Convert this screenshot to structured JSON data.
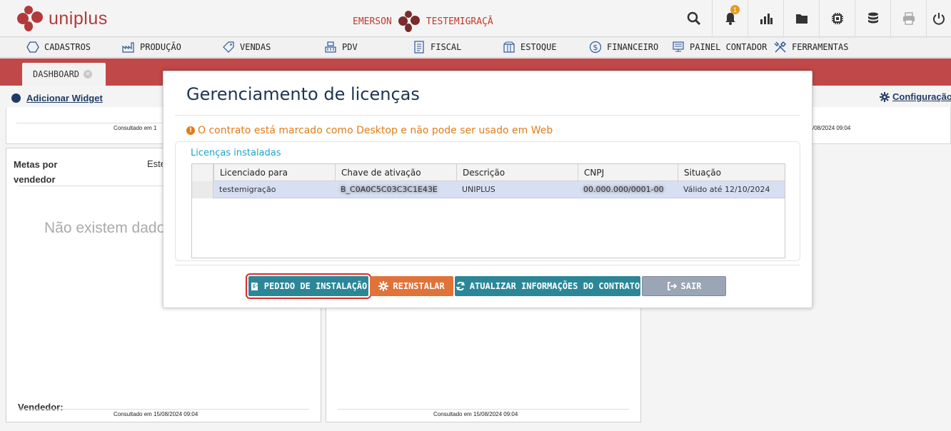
{
  "app": {
    "logo_text": "uniplus",
    "user_name": "EMERSON",
    "company": "TESTEMIGRAÇÃ",
    "notification_count": "1"
  },
  "menu": {
    "items": [
      {
        "label": "CADASTROS",
        "icon": "hexagon-icon"
      },
      {
        "label": "PRODUÇÃO",
        "icon": "factory-icon"
      },
      {
        "label": "VENDAS",
        "icon": "tag-icon"
      },
      {
        "label": "PDV",
        "icon": "register-icon"
      },
      {
        "label": "FISCAL",
        "icon": "document-icon"
      },
      {
        "label": "ESTOQUE",
        "icon": "box-icon"
      },
      {
        "label": "FINANCEIRO",
        "icon": "dollar-icon"
      },
      {
        "label": "PAINEL CONTADOR",
        "icon": "monitor-icon"
      },
      {
        "label": "FERRAMENTAS",
        "icon": "tools-icon"
      }
    ]
  },
  "tabs": {
    "dashboard": "DASHBOARD"
  },
  "dashboard": {
    "add_widget": "Adicionar Widget",
    "config": "Configuração",
    "consult_left": "Consultado em 1",
    "consult_right": "/08/2024 09:04",
    "widget1": {
      "title_line1": "Metas por",
      "title_line2": "vendedor",
      "est": "Este",
      "no_data": "Não existem dados",
      "vendedor": "Vendedor:",
      "consult": "Consultado em 15/08/2024 09:04"
    },
    "widget2": {
      "consult": "Consultado em 15/08/2024 09:04"
    }
  },
  "modal": {
    "title": "Gerenciamento de licenças",
    "warning": "O contrato está marcado como Desktop e não pode ser usado em Web",
    "panel_title": "Licenças instaladas",
    "columns": [
      "Licenciado para",
      "Chave de ativação",
      "Descrição",
      "CNPJ",
      "Situação"
    ],
    "row": {
      "licenciado": "testemigração",
      "chave": "B_C0A0C5C03C3C1E43E",
      "descricao": "UNIPLUS",
      "cnpj": "00.000.000/0001-00",
      "situacao": "Válido até 12/10/2024"
    },
    "buttons": {
      "pedido": "PEDIDO DE INSTALAÇÃO",
      "reinstalar": "REINSTALAR",
      "atualizar": "ATUALIZAR INFORMAÇÕES DO CONTRATO",
      "sair": "SAIR"
    }
  },
  "colors": {
    "brand": "#b23a3a",
    "tabstrip": "#c04848",
    "teal": "#2b8797",
    "orange": "#e0733a",
    "warning": "#e07d1a",
    "highlight": "#d62b2b"
  }
}
